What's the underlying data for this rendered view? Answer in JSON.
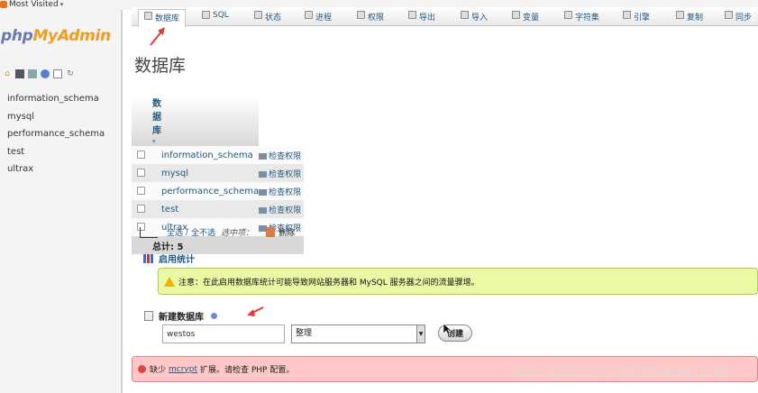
{
  "bookmarks": {
    "label": "Most Visited"
  },
  "sidebar": {
    "logo_php": "php",
    "logo_myadmin": "MyAdmin",
    "databases": [
      "information_schema",
      "mysql",
      "performance_schema",
      "test",
      "ultrax"
    ]
  },
  "tabs": [
    "数据库",
    "SQL",
    "状态",
    "进程",
    "权限",
    "导出",
    "导入",
    "变量",
    "字符集",
    "引擎",
    "复制",
    "同步"
  ],
  "page": {
    "title": "数据库"
  },
  "table": {
    "header": "数据库",
    "privilege_label": "检查权限",
    "rows": [
      "information_schema",
      "mysql",
      "performance_schema",
      "test",
      "ultrax"
    ],
    "total": "总计: 5"
  },
  "bulk": {
    "select_all": "全选",
    "separator": "/",
    "select_none": "全不选",
    "with_selected": "选中项：",
    "delete": "删除"
  },
  "stats": {
    "heading": "启用统计",
    "notice": "注意：在此启用数据库统计可能导致网站服务器和 MySQL 服务器之间的流量骤增。"
  },
  "create_db": {
    "heading": "新建数据库",
    "name_value": "westos",
    "collation_value": "整理",
    "button": "创建"
  },
  "error": {
    "prefix": "缺少",
    "link": "mcrypt",
    "suffix": "扩展。请检查 PHP 配置。"
  },
  "watermark": "https://blog.csdn.net/chenfeifei12345",
  "colors": {
    "link": "#235a81",
    "logo_orange": "#f29c1c",
    "logo_blue": "#6c78af",
    "notice_bg": "#ebf8a4",
    "error_bg": "#ffc8c8",
    "annotation_red": "#e53b2c"
  }
}
